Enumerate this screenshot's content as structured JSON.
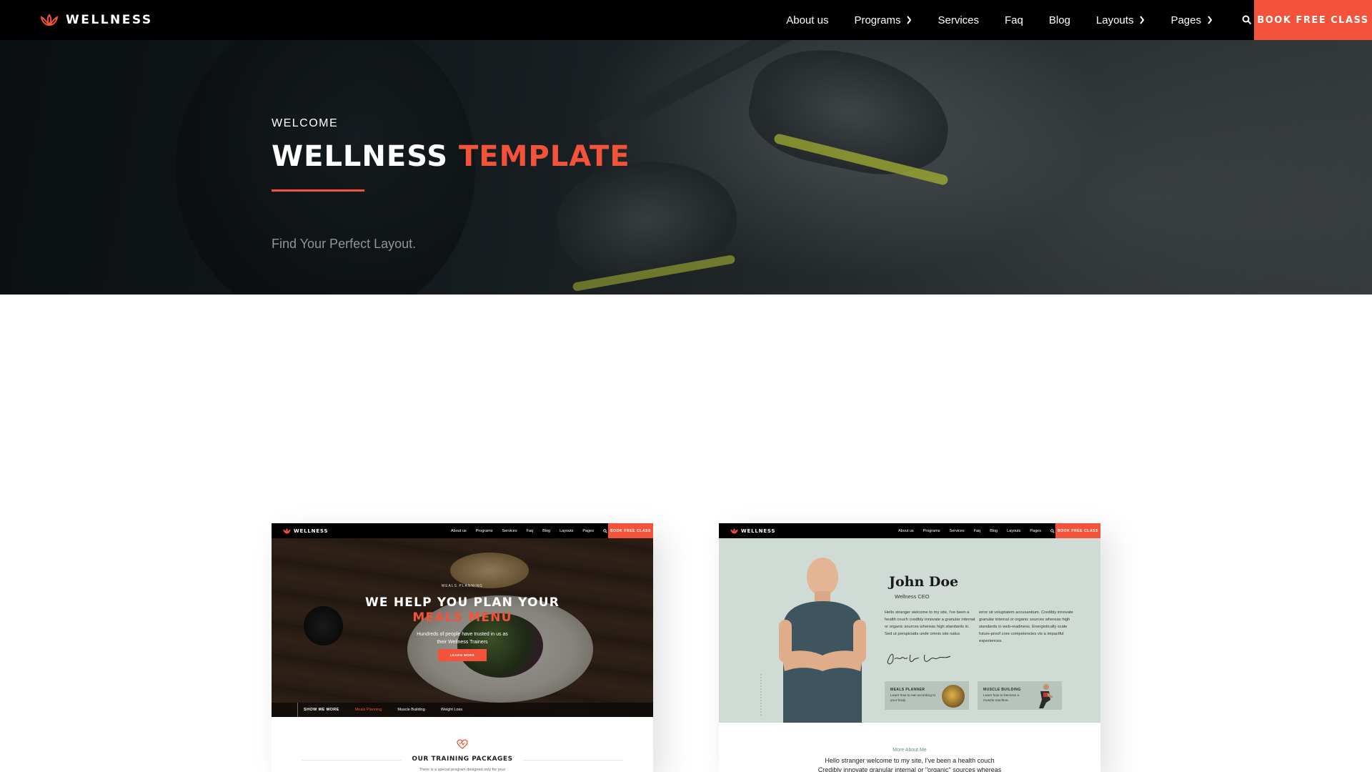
{
  "nav": {
    "brand": "WELLNESS",
    "items": [
      {
        "label": "About us",
        "has_submenu": false
      },
      {
        "label": "Programs",
        "has_submenu": true
      },
      {
        "label": "Services",
        "has_submenu": false
      },
      {
        "label": "Faq",
        "has_submenu": false
      },
      {
        "label": "Blog",
        "has_submenu": false
      },
      {
        "label": "Layouts",
        "has_submenu": true
      },
      {
        "label": "Pages",
        "has_submenu": true
      }
    ],
    "search_icon": "search-icon",
    "cta_label": "BOOK FREE CLASS"
  },
  "hero": {
    "kicker": "WELCOME",
    "title_main": "WELLNESS",
    "title_accent": "TEMPLATE",
    "subtitle": "Find Your Perfect Layout."
  },
  "cards": [
    {
      "mini_nav": {
        "brand": "WELLNESS",
        "items": [
          "About us",
          "Programs",
          "Services",
          "Faq",
          "Blog",
          "Layouts",
          "Pages"
        ],
        "cta": "BOOK FREE CLASS"
      },
      "kicker": "MEALS PLANNING",
      "title_line1": "WE HELP YOU PLAN YOUR",
      "title_line2": "MEALS MENU",
      "desc_line1": "Hundreds of people have trusted in us as",
      "desc_line2": "their Wellness Trainers",
      "button": "LEARN MORE",
      "tabs": [
        "SHOW ME MORE",
        "Meals Planning",
        "Muscle Building",
        "Weight Loss"
      ],
      "section_title": "OUR TRAINING PACKAGES",
      "section_sub": "There is a special program designed only for your"
    },
    {
      "mini_nav": {
        "brand": "WELLNESS",
        "items": [
          "About us",
          "Programs",
          "Services",
          "Faq",
          "Blog",
          "Layouts",
          "Pages"
        ],
        "cta": "BOOK FREE CLASS"
      },
      "name": "John Doe",
      "role": "Wellness CEO",
      "para_left": "Hello stranger welcome to my site, I've been a health couch credibly innovate a granular internal or organic sources whereas high standards in. Sed ut perspiciatis unde omnis iste natus",
      "para_right": "error sit voluptatem accusantium. Credibly innovate granular internal or organic sources whereas high standards in web-readiness. Energistically scale future-proof core competencies vis a impactful experiences.",
      "tile1_title": "MEALS PLANNER",
      "tile1_sub": "Learn how to eat according to your body.",
      "tile2_title": "MUSCLE BUILDING",
      "tile2_sub": "Learn how to become a muscle machine.",
      "more_label": "More About Me",
      "desc_line1": "Hello stranger welcome to my site, I've been a health couch",
      "desc_line2": "Credibly innovate granular internal or \"organic\" sources whereas"
    }
  ],
  "colors": {
    "accent": "#f2533a",
    "nav_bg": "#000000",
    "card2_bg": "#cfdbd4"
  }
}
